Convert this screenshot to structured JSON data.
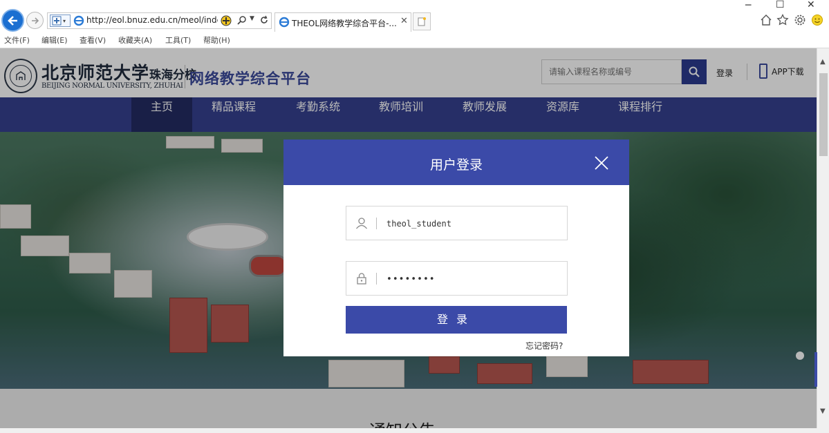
{
  "browser": {
    "url": "http://eol.bnuz.edu.cn/meol/inde",
    "tab_title": "THEOL网络教学综合平台-...",
    "menu": [
      "文件(F)",
      "编辑(E)",
      "查看(V)",
      "收藏夹(A)",
      "工具(T)",
      "帮助(H)"
    ]
  },
  "header": {
    "logo_cn": "北京师范大学",
    "logo_cn_sub": "珠海分校",
    "logo_en": "BEIJING NORMAL UNIVERSITY, ZHUHAI",
    "platform_name": "网络教学综合平台",
    "search_placeholder": "请输入课程名称或编号",
    "login_label": "登录",
    "app_label": "APP下载"
  },
  "nav": {
    "items": [
      "主页",
      "精品课程",
      "考勤系统",
      "教师培训",
      "教师发展",
      "资源库",
      "课程排行"
    ],
    "active_index": 0
  },
  "notice": {
    "title": "通知公告"
  },
  "login_modal": {
    "title": "用户登录",
    "username_value": "theol_student",
    "password_value": "••••••••",
    "submit_label": "登录",
    "forgot_label": "忘记密码?"
  },
  "colors": {
    "nav_bg": "#35418f",
    "nav_active": "#232c63",
    "modal_accent": "#3b4aa8"
  }
}
